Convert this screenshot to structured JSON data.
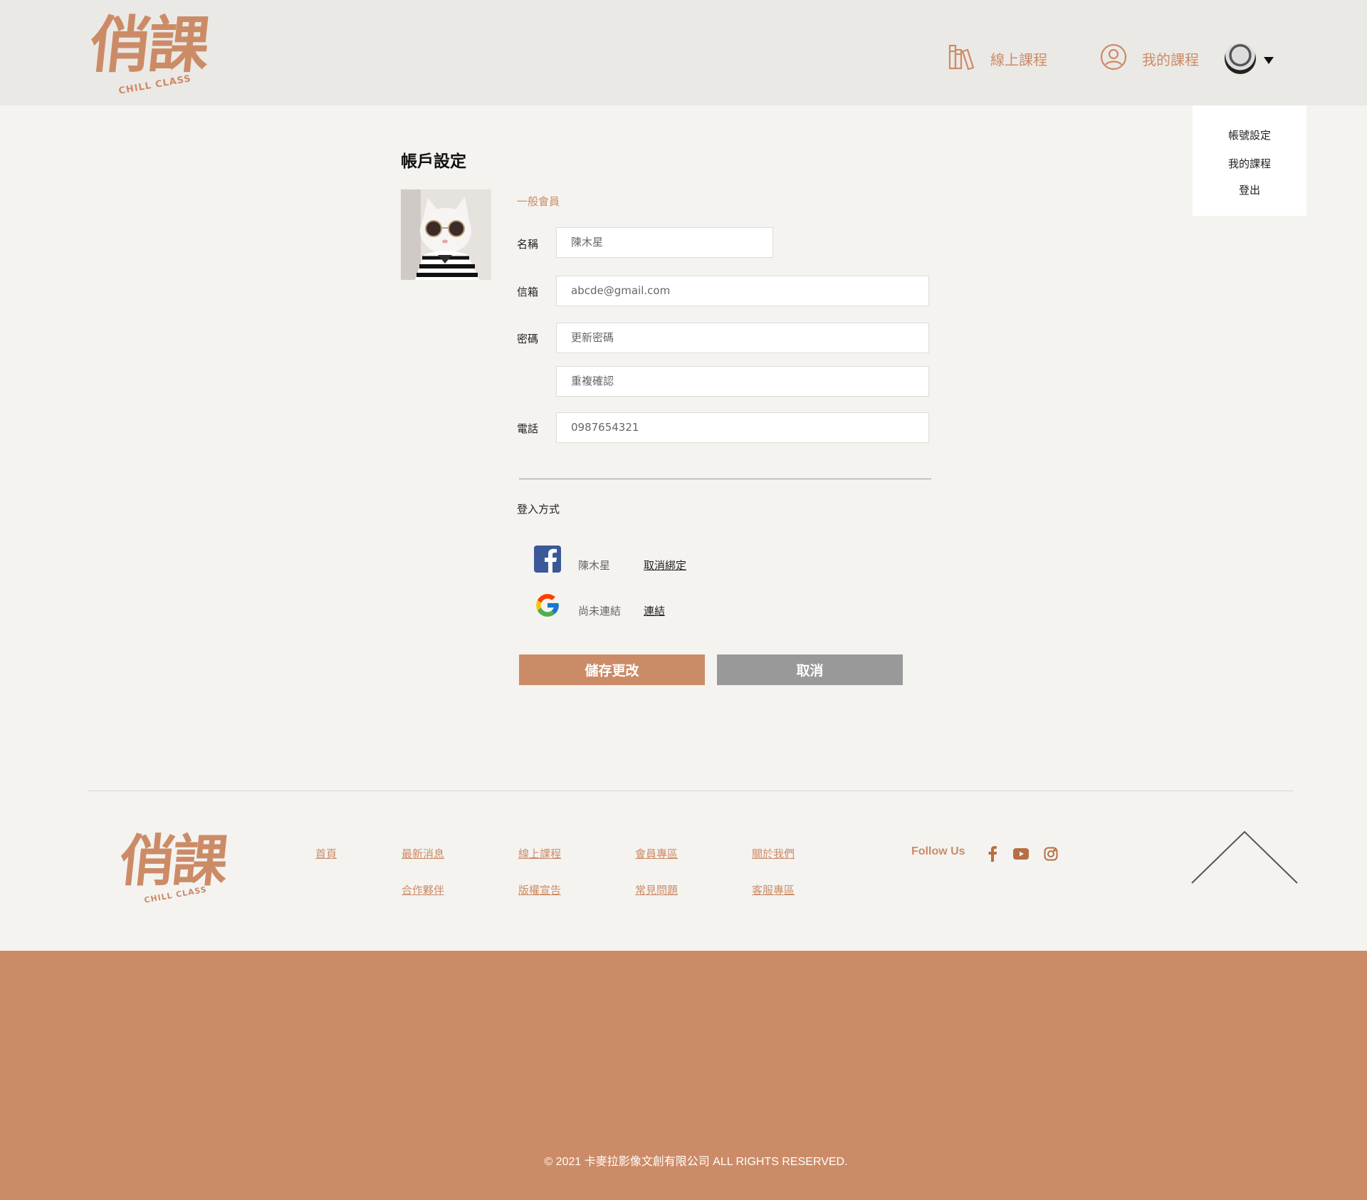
{
  "header": {
    "logo_text": "俏課",
    "logo_sub": "CHILL CLASS",
    "nav": [
      {
        "label": "線上課程",
        "icon": "books-icon"
      },
      {
        "label": "我的課程",
        "icon": "user-circle-icon"
      }
    ],
    "avatar_icon": "cat-avatar-icon",
    "caret_icon": "caret-down-icon"
  },
  "dropdown": {
    "items": [
      "帳號設定",
      "我的課程",
      "登出"
    ]
  },
  "page": {
    "title": "帳戶設定",
    "member_type": "一般會員",
    "fields": {
      "name": {
        "label": "名稱",
        "value": "陳木星"
      },
      "email": {
        "label": "信箱",
        "value": "abcde@gmail.com"
      },
      "password": {
        "label": "密碼",
        "placeholder": "更新密碼"
      },
      "password_confirm": {
        "placeholder": "重複確認"
      },
      "phone": {
        "label": "電話",
        "value": "0987654321"
      }
    },
    "login_section": {
      "label": "登入方式",
      "providers": [
        {
          "provider": "facebook",
          "icon": "facebook-icon",
          "name": "陳木星",
          "action": "取消綁定"
        },
        {
          "provider": "google",
          "icon": "google-icon",
          "name": "尚未連結",
          "action": "連結"
        }
      ]
    },
    "buttons": {
      "save": "儲存更改",
      "cancel": "取消"
    }
  },
  "footer": {
    "logo_text": "俏課",
    "logo_sub": "CHILL CLASS",
    "links_row1": [
      "首頁",
      "最新消息",
      "線上課程",
      "會員專區",
      "關於我們"
    ],
    "links_row2": [
      "合作夥伴",
      "版權宣告",
      "常見問題",
      "客服專區"
    ],
    "follow_label": "Follow Us",
    "social_icons": [
      "facebook-icon",
      "youtube-icon",
      "instagram-icon"
    ],
    "back_to_top_icon": "chevron-up-icon",
    "copyright": "© 2021 卡麥拉影像文創有限公司 ALL RIGHTS RESERVED."
  },
  "colors": {
    "accent": "#cc8b67",
    "header_bg": "#ebe9e5",
    "page_bg": "#f4f3f0",
    "cancel_button": "#999999"
  }
}
